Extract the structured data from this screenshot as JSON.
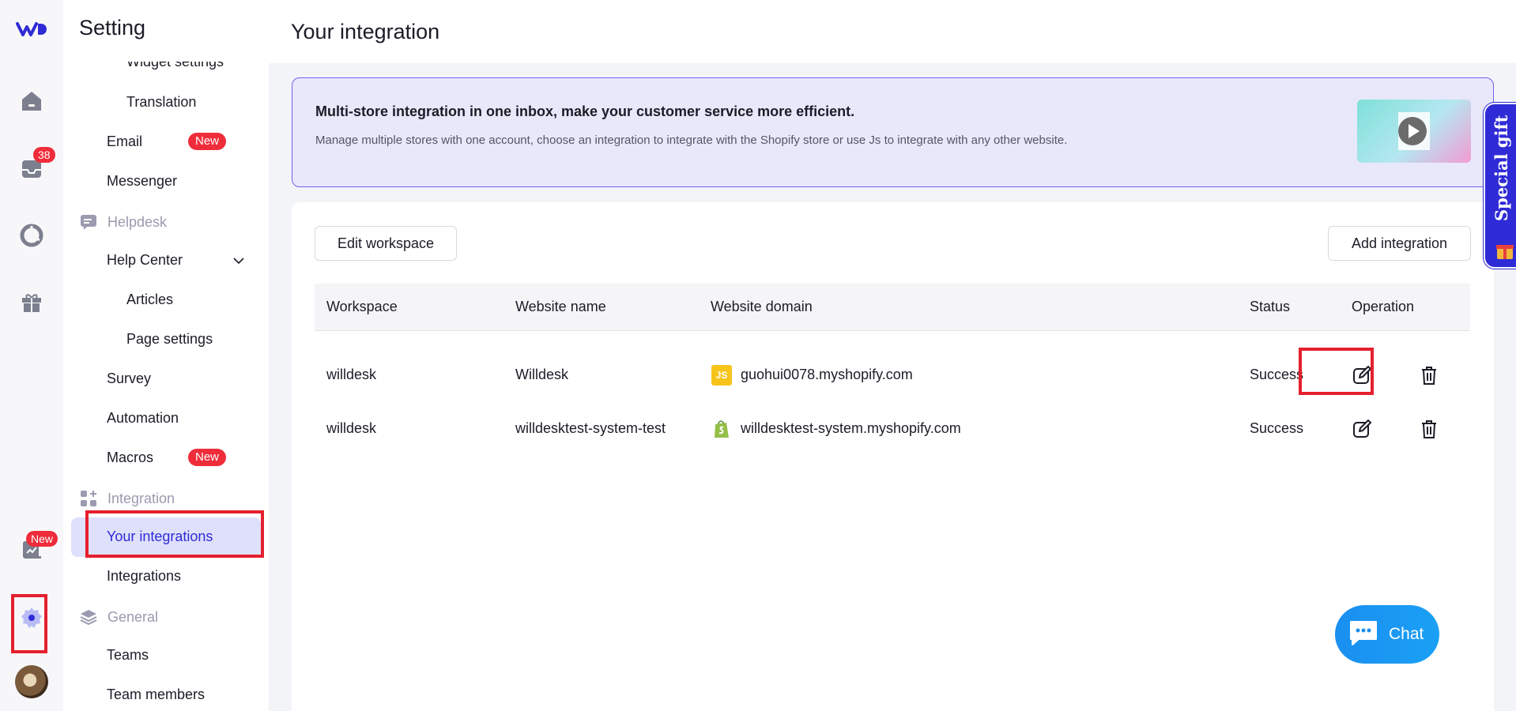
{
  "app": {
    "logo": "willdesk-logo",
    "rail": {
      "inbox_badge": "38",
      "reports_badge": "New"
    }
  },
  "sidebar": {
    "title": "Setting",
    "items": {
      "widget_settings": "Widget settings",
      "translation": "Translation",
      "email": "Email",
      "email_badge": "New",
      "messenger": "Messenger",
      "helpdesk_section": "Helpdesk",
      "help_center": "Help Center",
      "articles": "Articles",
      "page_settings": "Page settings",
      "survey": "Survey",
      "automation": "Automation",
      "macros": "Macros",
      "macros_badge": "New",
      "integration_section": "Integration",
      "your_integrations": "Your integrations",
      "integrations": "Integrations",
      "general_section": "General",
      "teams": "Teams",
      "team_members": "Team members"
    }
  },
  "main": {
    "title": "Your integration",
    "banner": {
      "title": "Multi-store integration in one inbox, make your customer service more efficient.",
      "description": "Manage multiple stores with one account, choose an integration to integrate with the Shopify store or use Js to integrate with any other website."
    },
    "edit_workspace_label": "Edit workspace",
    "add_integration_label": "Add integration",
    "table": {
      "headers": {
        "workspace": "Workspace",
        "website_name": "Website name",
        "website_domain": "Website domain",
        "status": "Status",
        "operation": "Operation"
      },
      "rows": [
        {
          "workspace": "willdesk",
          "website_name": "Willdesk",
          "domain_type": "JS",
          "website_domain": "guohui0078.myshopify.com",
          "status": "Success"
        },
        {
          "workspace": "willdesk",
          "website_name": "willdesktest-system-test",
          "domain_type": "shopify",
          "website_domain": "willdesktest-system.myshopify.com",
          "status": "Success"
        }
      ]
    }
  },
  "special_gift": "Special gift",
  "chat_widget": "Chat",
  "colors": {
    "accent": "#2f2bd6",
    "badge": "#ef2c3a",
    "highlight": "#e5202e",
    "active_bg": "#dfe0fb"
  }
}
